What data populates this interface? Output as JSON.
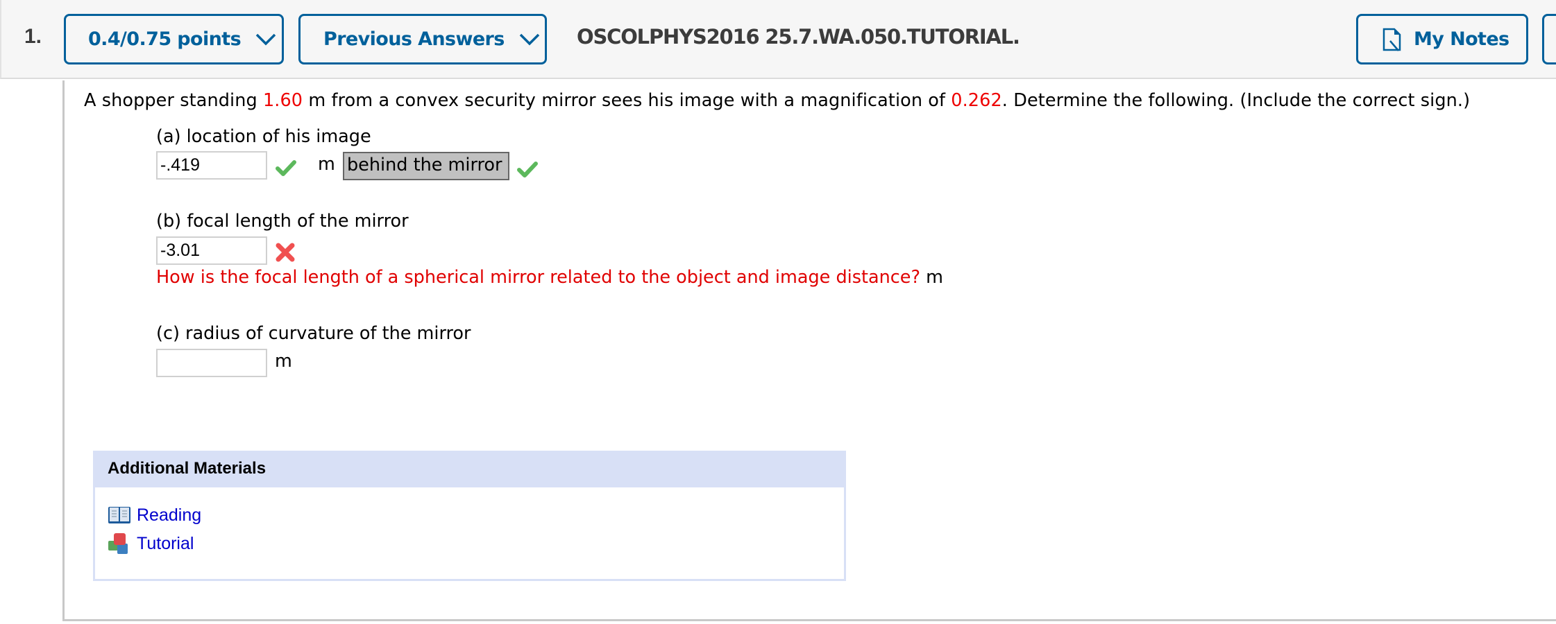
{
  "header": {
    "question_number": "1.",
    "points_button": "0.4/0.75 points",
    "previous_answers_button": "Previous Answers",
    "question_id": "OSCOLPHYS2016 25.7.WA.050.TUTORIAL.",
    "my_notes_button": "My Notes",
    "brand_color": "#00609b"
  },
  "question": {
    "prompt_before_distance": "A shopper standing ",
    "distance_value": "1.60",
    "prompt_after_distance": " m from a convex security mirror sees his image with a magnification of ",
    "magnification_value": "0.262",
    "prompt_end": ". Determine the following. (Include the correct sign.)",
    "highlight_color": "#ee0000"
  },
  "parts": [
    {
      "label": "(a) location of his image",
      "answer_value": "-.419",
      "unit": "m",
      "status": "correct",
      "select_value": "behind the mirror",
      "select_status": "correct"
    },
    {
      "label": "(b) focal length of the mirror",
      "answer_value": "-3.01",
      "status": "incorrect",
      "hint": "How is the focal length of a spherical mirror related to the object and image distance?",
      "unit": "m"
    },
    {
      "label": "(c) radius of curvature of the mirror",
      "answer_value": "",
      "unit": "m"
    }
  ],
  "additional_materials": {
    "title": "Additional Materials",
    "links": [
      {
        "label": "Reading",
        "icon": "book-icon"
      },
      {
        "label": "Tutorial",
        "icon": "cubes-icon"
      }
    ]
  }
}
